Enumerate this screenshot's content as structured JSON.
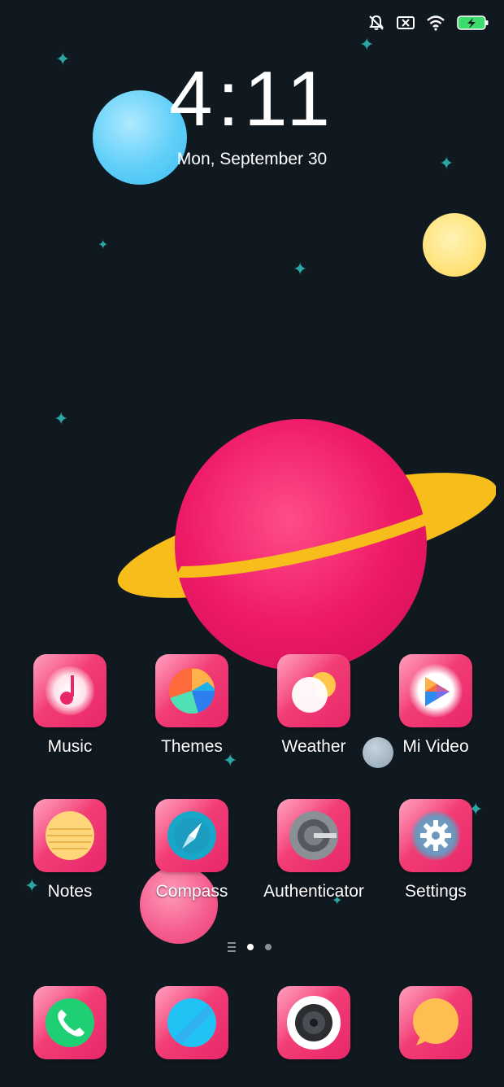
{
  "status_bar": {
    "icons": [
      "mute-icon",
      "no-sim-icon",
      "wifi-icon",
      "battery-charging-icon"
    ],
    "battery_color": "#3ddc6e"
  },
  "lockclock": {
    "time": "4:11",
    "date": "Mon, September 30"
  },
  "apps_row1": [
    {
      "label": "Music",
      "icon": "music-note-icon"
    },
    {
      "label": "Themes",
      "icon": "themes-icon"
    },
    {
      "label": "Weather",
      "icon": "weather-icon"
    },
    {
      "label": "Mi Video",
      "icon": "play-icon"
    }
  ],
  "apps_row2": [
    {
      "label": "Notes",
      "icon": "notes-icon"
    },
    {
      "label": "Compass",
      "icon": "compass-icon"
    },
    {
      "label": "Authenticator",
      "icon": "authenticator-icon"
    },
    {
      "label": "Settings",
      "icon": "gear-icon"
    }
  ],
  "dock": [
    {
      "icon": "phone-icon"
    },
    {
      "icon": "browser-icon"
    },
    {
      "icon": "camera-icon"
    },
    {
      "icon": "messaging-icon"
    }
  ],
  "pager": {
    "pages": 2,
    "active": 1
  },
  "colors": {
    "background": "#101820",
    "icon_pink": "#f23d75",
    "star_teal": "#2aa7a4"
  }
}
